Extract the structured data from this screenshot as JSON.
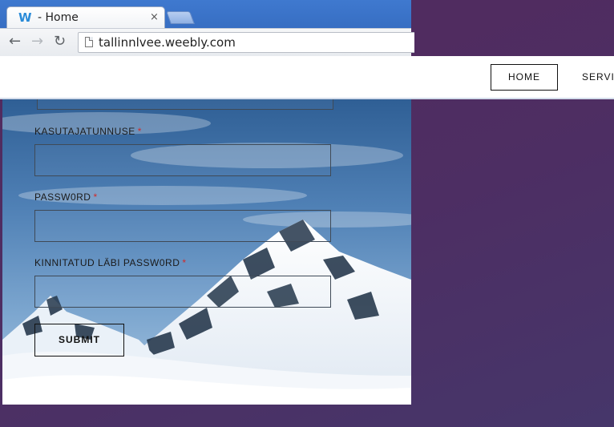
{
  "browser": {
    "tab_title": "- Home",
    "tab_close": "×",
    "favicon": "W",
    "url": "tallinnlvee.weebly.com",
    "icons": {
      "back": "back-arrow-icon",
      "forward": "forward-arrow-icon",
      "reload": "reload-icon",
      "page": "page-icon"
    }
  },
  "site_nav": {
    "items": [
      {
        "label": "HOME",
        "active": true
      },
      {
        "label": "SERVI",
        "active": false
      }
    ]
  },
  "form": {
    "fields": [
      {
        "label": "KASUTAJATUNNUSE",
        "required": "*",
        "value": ""
      },
      {
        "label": "PASSW0RD",
        "required": "*",
        "value": ""
      },
      {
        "label": "KINNITATUD LÄBI PASSW0RD",
        "required": "*",
        "value": ""
      }
    ],
    "submit_label": "SUBMIT"
  },
  "colors": {
    "background": "#532a5d",
    "required": "#d12a2a",
    "chrome_blue": "#3f79cf"
  }
}
